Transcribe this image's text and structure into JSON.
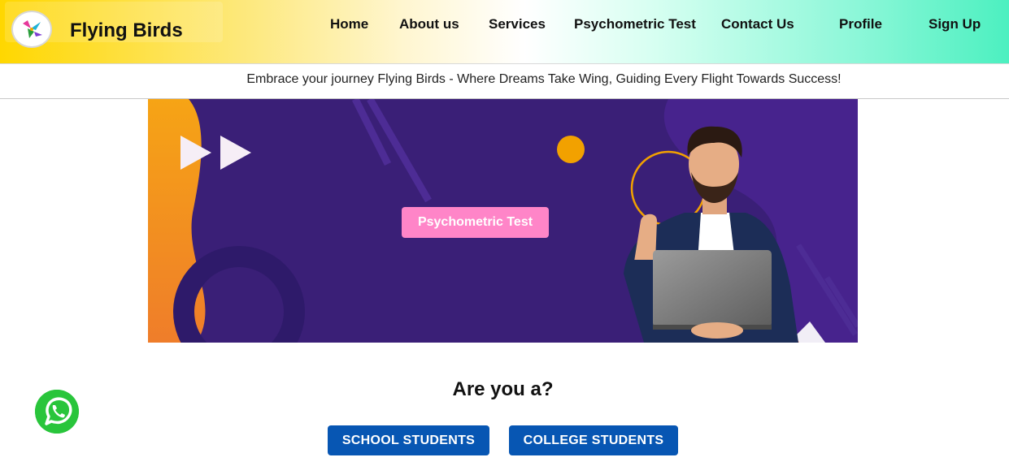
{
  "header": {
    "brand": "Flying Birds",
    "nav": [
      "Home",
      "About us",
      "Services",
      "Psychometric Test",
      "Contact Us",
      "Profile",
      "Sign Up"
    ]
  },
  "tagline": "Embrace your journey Flying Birds - Where Dreams Take Wing, Guiding Every Flight Towards Success!",
  "banner": {
    "cta_label": "Psychometric Test"
  },
  "audience": {
    "question": "Are you a?",
    "options": [
      "SCHOOL STUDENTS",
      "COLLEGE STUDENTS"
    ]
  },
  "colors": {
    "cta": "#ff85c8",
    "choice_button": "#0756b3",
    "banner_bg": "#3a1f77",
    "whatsapp": "#29c53b"
  },
  "icons": [
    "bird-logo-icon",
    "play-arrows-icon",
    "whatsapp-icon"
  ]
}
